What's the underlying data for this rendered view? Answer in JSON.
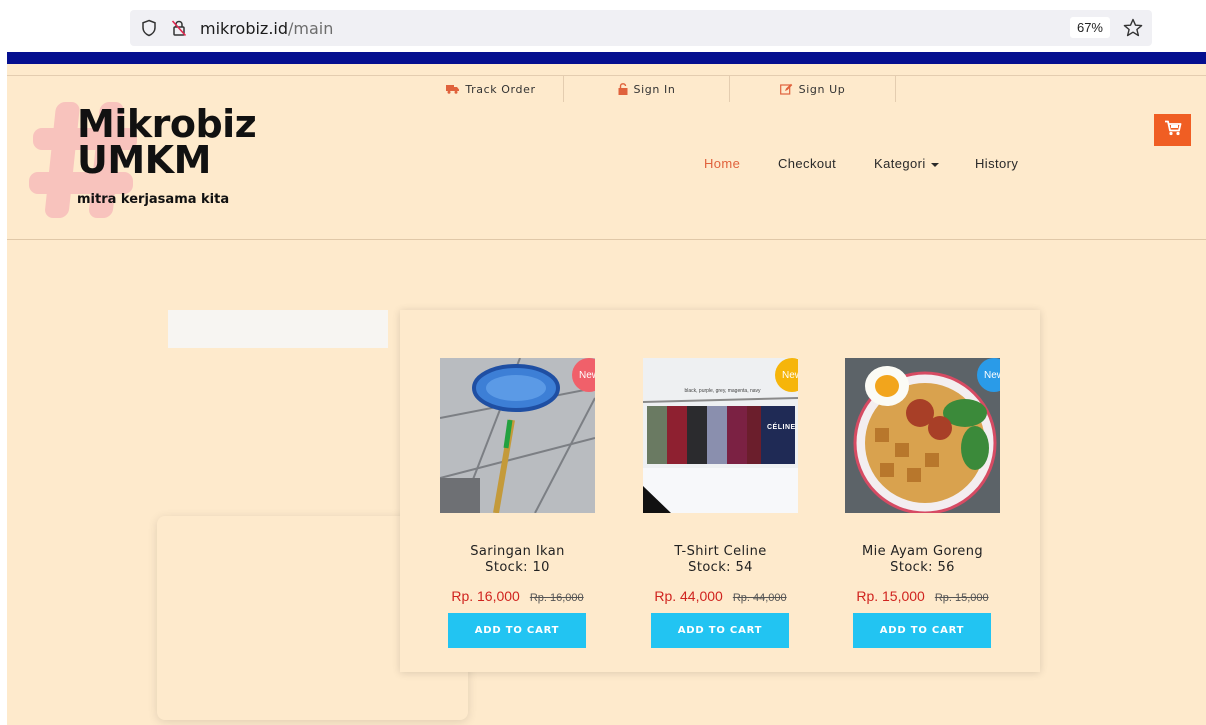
{
  "browser": {
    "url_host": "mikrobiz.id",
    "url_path": "/main",
    "zoom": "67%"
  },
  "top_links": [
    {
      "label": "Track Order",
      "icon": "truck-icon"
    },
    {
      "label": "Sign In",
      "icon": "lock-icon"
    },
    {
      "label": "Sign Up",
      "icon": "edit-icon"
    }
  ],
  "logo": {
    "title_line1": "Mikrobiz",
    "title_line2": "UMKM",
    "tagline": "mitra kerjasama kita"
  },
  "nav": {
    "items": [
      {
        "label": "Home",
        "active": true
      },
      {
        "label": "Checkout",
        "active": false
      },
      {
        "label": "Kategori",
        "active": false,
        "dropdown": true
      },
      {
        "label": "History",
        "active": false
      }
    ]
  },
  "colors": {
    "accent": "#e0623c",
    "cart": "#f05e23",
    "button": "#22c4f2",
    "price": "#d0241f",
    "background": "#feeacc",
    "top_strip": "#050f8f"
  },
  "products": [
    {
      "name": "Saringan Ikan",
      "stock": "Stock: 10",
      "price": "Rp. 16,000",
      "old_price": "Rp. 16,000",
      "badge": "New",
      "badge_color": "#f0606a",
      "button": "ADD TO CART"
    },
    {
      "name": "T-Shirt Celine",
      "stock": "Stock: 54",
      "price": "Rp. 44,000",
      "old_price": "Rp. 44,000",
      "badge": "New",
      "badge_color": "#f6b50a",
      "button": "ADD TO CART",
      "image_caption": "black, purple, grey, magenta, navy",
      "shirt_text": "CÉLINE"
    },
    {
      "name": "Mie Ayam Goreng",
      "stock": "Stock: 56",
      "price": "Rp. 15,000",
      "old_price": "Rp. 15,000",
      "badge": "New",
      "badge_color": "#2a9be8",
      "button": "ADD TO CART"
    }
  ]
}
